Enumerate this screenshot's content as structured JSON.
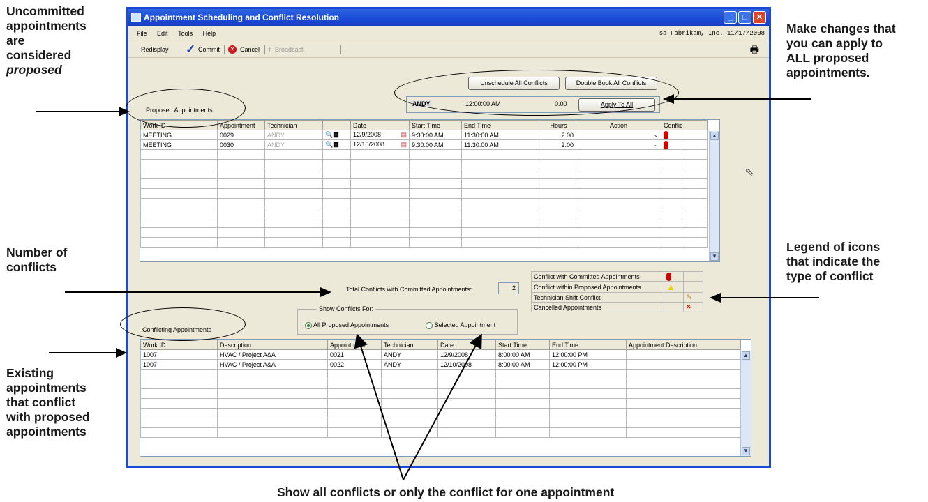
{
  "annotations": {
    "top_left": [
      "Uncommitted",
      "appointments",
      "are",
      "considered",
      "proposed"
    ],
    "top_right": [
      "Make changes that",
      "you can apply to",
      "ALL proposed",
      "appointments."
    ],
    "number_conflicts": [
      "Number of",
      "conflicts"
    ],
    "legend_note": [
      "Legend of icons",
      "that indicate the",
      "type of conflict"
    ],
    "existing": [
      "Existing",
      "appointments",
      "that conflict",
      "with proposed",
      "appointments"
    ],
    "bottom": "Show all conflicts or only the conflict for one appointment"
  },
  "window": {
    "title": "Appointment Scheduling and Conflict Resolution",
    "menu": [
      "File",
      "Edit",
      "Tools",
      "Help"
    ],
    "company": "sa  Fabrikam, Inc.  11/17/2008",
    "toolbar": {
      "redisplay": "Redisplay",
      "commit": "Commit",
      "cancel": "Cancel",
      "broadcast": "Broadcast"
    }
  },
  "actions": {
    "unschedule": "Unschedule All Conflicts",
    "double_book": "Double Book All Conflicts",
    "tech_value": "ANDY",
    "time_value": "12:00:00 AM",
    "hours_value": "0.00",
    "apply": "Apply To All"
  },
  "proposed": {
    "label": "Proposed Appointments",
    "headers": [
      "Work ID",
      "Appointment",
      "Technician",
      "",
      "Date",
      "Start Time",
      "End Time",
      "Hours",
      "Action",
      "Conflict"
    ],
    "rows": [
      {
        "work_id": "MEETING",
        "appointment": "0029",
        "technician": "ANDY",
        "date": "12/9/2008",
        "start": "9:30:00 AM",
        "end": "11:30:00 AM",
        "hours": "2.00"
      },
      {
        "work_id": "MEETING",
        "appointment": "0030",
        "technician": "ANDY",
        "date": "12/10/2008",
        "start": "9:30:00 AM",
        "end": "11:30:00 AM",
        "hours": "2.00"
      }
    ]
  },
  "total_conflicts": {
    "label": "Total Conflicts with Committed Appointments:",
    "value": "2"
  },
  "legend": {
    "committed": "Conflict with Committed Appointments",
    "proposed": "Conflict within Proposed Appointments",
    "shift": "Technician Shift Conflict",
    "cancelled": "Cancelled Appointments"
  },
  "show_conflicts": {
    "label": "Show Conflicts For:",
    "all": "All Proposed Appointments",
    "selected": "Selected Appointment"
  },
  "conflicting": {
    "label": "Conflicting Appointments",
    "headers": [
      "Work ID",
      "Description",
      "Appointment",
      "Technician",
      "Date",
      "Start Time",
      "End Time",
      "Appointment Description"
    ],
    "rows": [
      {
        "work_id": "1007",
        "description": "HVAC / Project A&A",
        "appointment": "0021",
        "technician": "ANDY",
        "date": "12/9/2008",
        "start": "8:00:00 AM",
        "end": "12:00:00 PM"
      },
      {
        "work_id": "1007",
        "description": "HVAC / Project A&A",
        "appointment": "0022",
        "technician": "ANDY",
        "date": "12/10/2008",
        "start": "8:00:00 AM",
        "end": "12:00:00 PM"
      }
    ]
  }
}
